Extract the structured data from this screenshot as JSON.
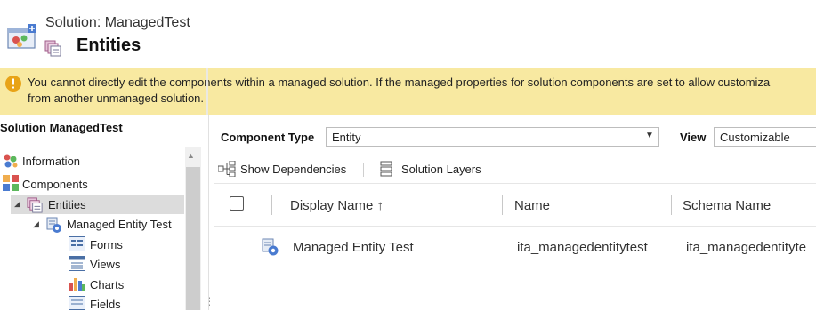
{
  "header": {
    "solution_title": "Solution: ManagedTest",
    "page_title": "Entities"
  },
  "warning": {
    "line1": "You cannot directly edit the components within a managed solution. If the managed properties for solution components are set to allow customiza",
    "line2": "from another unmanaged solution."
  },
  "tree": {
    "title": "Solution ManagedTest",
    "items": [
      {
        "label": "Information",
        "icon": "information-icon"
      },
      {
        "label": "Components",
        "icon": "components-icon"
      },
      {
        "label": "Entities",
        "icon": "entities-icon",
        "selected": true
      },
      {
        "label": "Managed Entity Test",
        "icon": "entity-gear-icon"
      },
      {
        "label": "Forms",
        "icon": "forms-icon"
      },
      {
        "label": "Views",
        "icon": "views-icon"
      },
      {
        "label": "Charts",
        "icon": "charts-icon"
      },
      {
        "label": "Fields",
        "icon": "fields-icon"
      }
    ]
  },
  "filters": {
    "component_type_label": "Component Type",
    "component_type_value": "Entity",
    "view_label": "View",
    "view_value": "Customizable"
  },
  "toolbar": {
    "show_dependencies": "Show Dependencies",
    "solution_layers": "Solution Layers"
  },
  "grid": {
    "columns": [
      "Display Name ↑",
      "Name",
      "Schema Name"
    ],
    "rows": [
      {
        "display_name": "Managed Entity Test",
        "name": "ita_managedentitytest",
        "schema_name": "ita_managedentityte"
      }
    ]
  },
  "colors": {
    "warning_bg": "#f8e9a1",
    "warning_icon": "#e8a317",
    "selection": "#dcdcdc"
  }
}
